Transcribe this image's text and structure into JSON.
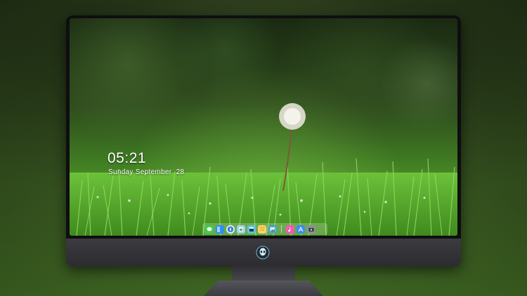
{
  "lock_screen": {
    "time": "05:21",
    "date": "Sunday September  28"
  },
  "dock": {
    "apps": [
      {
        "icon": "messages-icon",
        "color": "#3ccf4e"
      },
      {
        "icon": "finder-icon",
        "color": "#2f8ff0"
      },
      {
        "icon": "safari-icon",
        "color": "#e9eef5"
      },
      {
        "icon": "preview-icon",
        "color": "#9fd0f0"
      },
      {
        "icon": "claquette-icon",
        "color": "#59c6d8"
      },
      {
        "icon": "notes-icon",
        "color": "#f5d66a"
      },
      {
        "icon": "photos-gallery-icon",
        "color": "#4aa3c9"
      },
      {
        "icon": "itunes-icon",
        "color": "#ef5bb2"
      },
      {
        "icon": "app-store-icon",
        "color": "#3b8df0"
      },
      {
        "icon": "camera-icon",
        "color": "#8c9096"
      }
    ]
  },
  "monitor": {
    "logo": "alien-logo-icon"
  }
}
